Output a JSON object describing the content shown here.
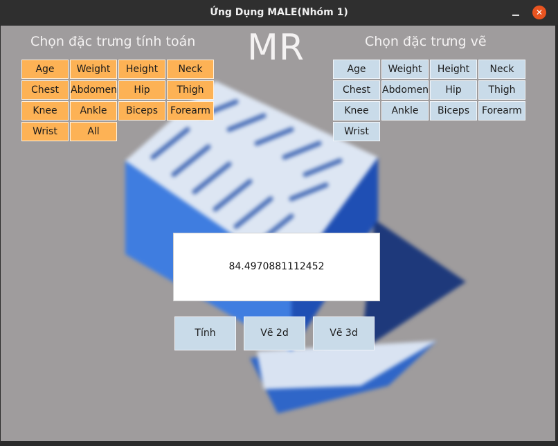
{
  "window": {
    "title": "Ứng Dụng MALE(Nhóm 1)"
  },
  "heading": {
    "compute": "Chọn đặc trưng tính toán",
    "app_logo": "MR",
    "plot": "Chọn đặc trưng vẽ"
  },
  "compute_features": [
    "Age",
    "Weight",
    "Height",
    "Neck",
    "Chest",
    "Abdomen",
    "Hip",
    "Thigh",
    "Knee",
    "Ankle",
    "Biceps",
    "Forearm",
    "Wrist",
    "All"
  ],
  "plot_features": [
    "Age",
    "Weight",
    "Height",
    "Neck",
    "Chest",
    "Abdomen",
    "Hip",
    "Thigh",
    "Knee",
    "Ankle",
    "Biceps",
    "Forearm",
    "Wrist"
  ],
  "result": {
    "value": "84.4970881112452"
  },
  "actions": {
    "compute": "Tính",
    "plot2d": "Vẽ 2d",
    "plot3d": "Vẽ 3d"
  },
  "colors": {
    "compute_button": "#fdb255",
    "plot_button": "#c9dbe9",
    "close": "#e95420"
  }
}
